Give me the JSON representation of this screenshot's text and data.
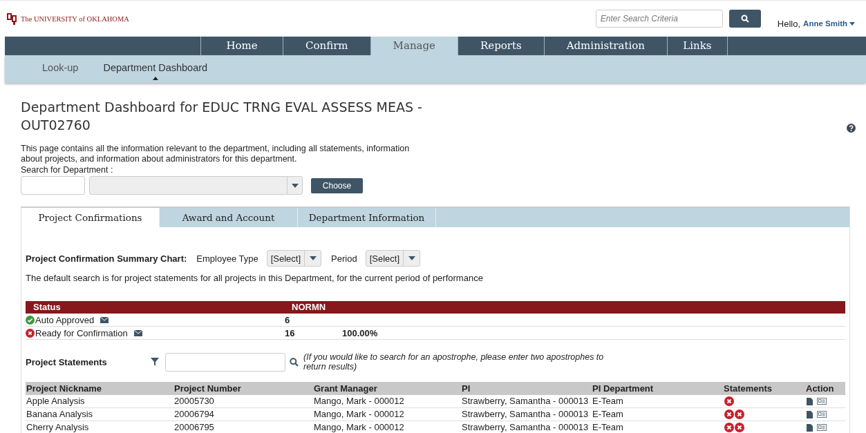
{
  "header": {
    "logo_text": "The UNIVERSITY of OKLAHOMA",
    "search": {
      "placeholder": "Enter Search Criteria"
    },
    "greeting": "Hello,",
    "user": "Anne Smith"
  },
  "nav": [
    {
      "label": "Home",
      "selected": false
    },
    {
      "label": "Confirm",
      "selected": false
    },
    {
      "label": "Manage",
      "selected": true
    },
    {
      "label": "Reports",
      "selected": false
    },
    {
      "label": "Administration",
      "selected": false
    },
    {
      "label": "Links",
      "selected": false
    }
  ],
  "subnav": [
    {
      "label": "Look-up",
      "selected": false
    },
    {
      "label": "Department Dashboard",
      "selected": true
    }
  ],
  "title": "Department Dashboard for EDUC TRNG EVAL ASSESS MEAS - OUT02760",
  "description": "This page contains all the information relevant to the department, including all statements, information about projects, and information about administrators for this department.",
  "department_search": {
    "label": "Search for Department :",
    "button": "Choose"
  },
  "tabs": [
    {
      "label": "Project Confirmations",
      "selected": true
    },
    {
      "label": "Award and Account",
      "selected": false
    },
    {
      "label": "Department Information",
      "selected": false
    }
  ],
  "summary": {
    "label": "Project Confirmation Summary Chart:",
    "filters": [
      {
        "label": "Employee Type",
        "value": "[Select]"
      },
      {
        "label": "Period",
        "value": "[Select]"
      }
    ],
    "note": "The default search is for project statements for all projects in this Department, for the current period of performance"
  },
  "status_table": {
    "columns": [
      "Status",
      "NORMN"
    ],
    "rows": [
      {
        "kind": "approved",
        "label": "Auto Approved",
        "count": "6"
      },
      {
        "kind": "pending",
        "label": "Ready for Confirmation",
        "count": "16",
        "percent": "100.00%"
      }
    ]
  },
  "statements": {
    "label": "Project Statements",
    "hint": "(If you would like to search for an apostrophe, please enter two apostrophes to return results)",
    "columns": [
      "Project Nickname",
      "Project Number",
      "Grant Manager",
      "PI",
      "PI Department",
      "Statements",
      "Action"
    ],
    "rows": [
      {
        "cells": [
          "Apple Analysis",
          "20005730",
          "Mango, Mark - 000012",
          "Strawberry, Samantha - 000013",
          "E-Team"
        ],
        "statements": [
          {
            "kind": "rejected"
          }
        ]
      },
      {
        "cells": [
          "Banana Analysis",
          "20006794",
          "Mango, Mark - 000012",
          "Strawberry, Samantha - 000013",
          "E-Team"
        ],
        "statements": [
          {
            "kind": "rejected"
          },
          {
            "kind": "rejected"
          }
        ]
      },
      {
        "cells": [
          "Cherry Analysis",
          "20006795",
          "Mango, Mark - 000012",
          "Strawberry, Samantha - 000013",
          "E-Team"
        ],
        "statements": [
          {
            "kind": "rejected"
          },
          {
            "kind": "rejected"
          }
        ]
      }
    ]
  }
}
